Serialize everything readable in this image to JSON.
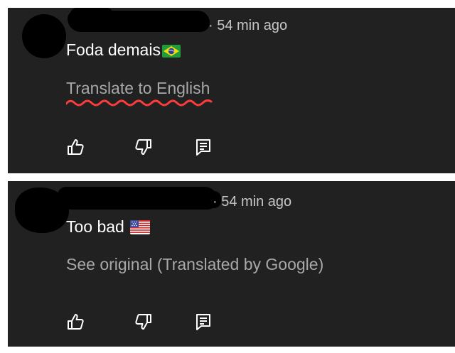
{
  "comments": [
    {
      "time": "· 54 min ago",
      "text": "Foda demais",
      "flag": "brazil-flag",
      "link": "Translate to English",
      "icons": [
        "thumbs-up-icon",
        "thumbs-down-icon",
        "reply-icon"
      ]
    },
    {
      "time": "· 54 min ago",
      "text": "Too bad",
      "flag": "us-flag",
      "link": "See original (Translated by Google)",
      "icons": [
        "thumbs-up-icon",
        "thumbs-down-icon",
        "reply-icon"
      ]
    }
  ],
  "colors": {
    "panel_bg": "#212121",
    "text": "#ffffff",
    "meta_text": "#c6c6c6",
    "link_text": "#a8a8a8",
    "squiggle": "#ff3b3b"
  }
}
